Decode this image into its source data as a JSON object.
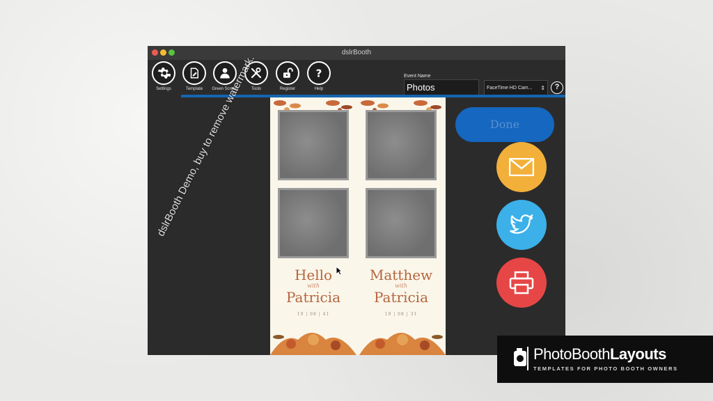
{
  "window": {
    "title": "dslrBooth"
  },
  "toolbar": {
    "items": [
      {
        "label": "Settings"
      },
      {
        "label": "Template"
      },
      {
        "label": "Green Screen"
      },
      {
        "label": "Tools"
      },
      {
        "label": "Register"
      },
      {
        "label": "Help"
      }
    ]
  },
  "event": {
    "label": "Event Name",
    "value": "Photos"
  },
  "camera": {
    "selected": "FaceTime HD Cam..."
  },
  "help_small": "?",
  "template": {
    "left": {
      "line1": "Hello",
      "with": "with",
      "line2": "Patricia",
      "date": "19 | 08 | 41"
    },
    "right": {
      "line1": "Matthew",
      "with": "with",
      "line2": "Patricia",
      "date": "19 | 08 | 31"
    }
  },
  "watermark": "dslrBooth Demo, buy to remove watermark.",
  "actions": {
    "done_label": "Done",
    "share": [
      {
        "icon": "envelope-icon"
      },
      {
        "icon": "twitter-bird-icon"
      },
      {
        "icon": "printer-icon"
      }
    ]
  },
  "branding": {
    "name_part1": "PhotoBooth",
    "name_part2": "Layouts",
    "tagline": "TEMPLATES FOR PHOTO BOOTH OWNERS"
  },
  "colors": {
    "toolbar_accent": "#1565b0",
    "done": "#1567c0",
    "email": "#f2b03a",
    "twitter": "#3cb0e8",
    "print": "#e74646"
  }
}
